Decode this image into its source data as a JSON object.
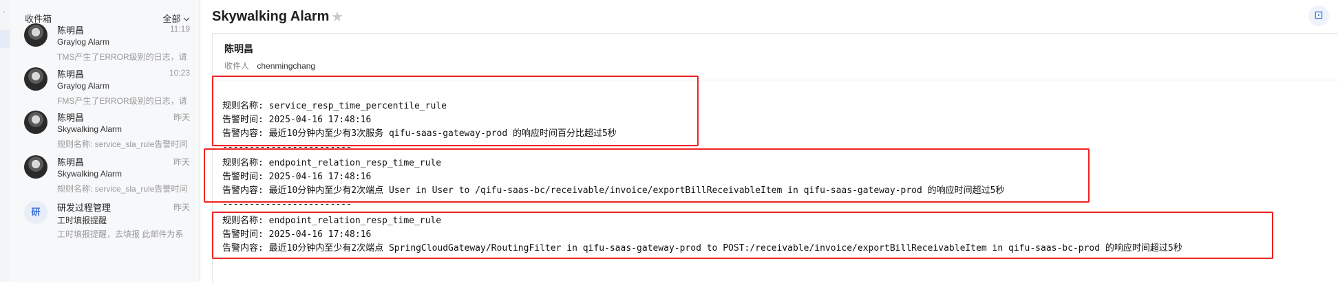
{
  "sidebar": {
    "rail_glyph": "·"
  },
  "mail_list": {
    "title": "收件箱",
    "filter": "全部",
    "filter_icon": "chevron-down-icon",
    "items": [
      {
        "sender": "陈明昌",
        "time": "11:19",
        "subject": "Graylog Alarm",
        "preview": "TMS产生了ERROR级别的日志，请",
        "avatar": "photo"
      },
      {
        "sender": "陈明昌",
        "time": "10:23",
        "subject": "Graylog Alarm",
        "preview": "FMS产生了ERROR级别的日志，请",
        "avatar": "photo"
      },
      {
        "sender": "陈明昌",
        "time": "昨天",
        "subject": "Skywalking Alarm",
        "preview": "规则名称: service_sla_rule告警时间",
        "avatar": "photo"
      },
      {
        "sender": "陈明昌",
        "time": "昨天",
        "subject": "Skywalking Alarm",
        "preview": "规则名称: service_sla_rule告警时间",
        "avatar": "photo"
      },
      {
        "sender": "研发过程管理",
        "time": "昨天",
        "subject": "工时填报提醒",
        "preview": "工时填报提醒，去填报 此邮件为系",
        "avatar": "研"
      }
    ]
  },
  "reader": {
    "title": "Skywalking Alarm",
    "star_icon": "star-icon",
    "scan_icon": "scan-icon",
    "from_name": "陈明昌",
    "to_label": "收件人",
    "to_value": "chenmingchang",
    "alerts": [
      {
        "rule": "规则名称: service_resp_time_percentile_rule",
        "time": "告警时间: 2025-04-16 17:48:16",
        "content": "告警内容: 最近10分钟内至少有3次服务 qifu-saas-gateway-prod 的响应时间百分比超过5秒"
      },
      {
        "rule": "规则名称: endpoint_relation_resp_time_rule",
        "time": "告警时间: 2025-04-16 17:48:16",
        "content": "告警内容: 最近10分钟内至少有2次端点 User in User to /qifu-saas-bc/receivable/invoice/exportBillReceivableItem in qifu-saas-gateway-prod 的响应时间超过5秒"
      },
      {
        "rule": "规则名称: endpoint_relation_resp_time_rule",
        "time": "告警时间: 2025-04-16 17:48:16",
        "content": "告警内容: 最近10分钟内至少有2次端点 SpringCloudGateway/RoutingFilter in qifu-saas-gateway-prod to POST:/receivable/invoice/exportBillReceivableItem in qifu-saas-bc-prod 的响应时间超过5秒"
      }
    ],
    "divider": "------------------------"
  },
  "colors": {
    "highlight_box": "#ee2222",
    "accent": "#3a6fd8"
  }
}
